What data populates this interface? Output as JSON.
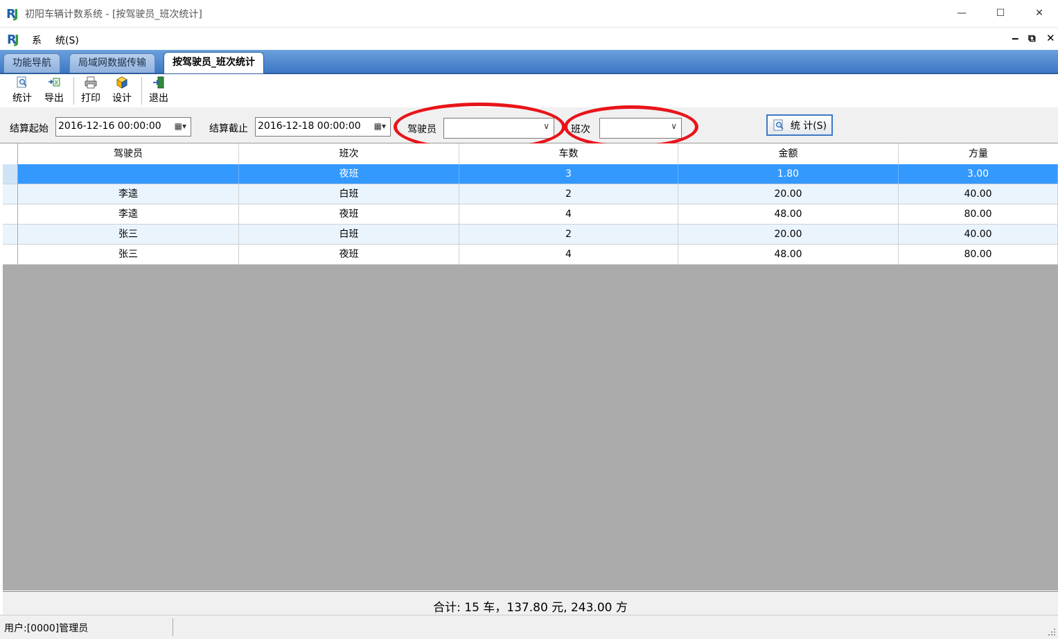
{
  "window": {
    "title": "初阳车辆计数系统 - [按驾驶员_班次统计]",
    "minimize": "—",
    "maximize": "☐",
    "close": "✕"
  },
  "menu": {
    "items": [
      "系",
      "统(S)"
    ],
    "mdi_min": "‒",
    "mdi_restore": "⧉",
    "mdi_close": "✕"
  },
  "tabs": [
    {
      "label": "功能导航",
      "active": false
    },
    {
      "label": "局域网数据传输",
      "active": false
    },
    {
      "label": "按驾驶员_班次统计",
      "active": true
    }
  ],
  "toolbar": {
    "buttons": [
      {
        "label": "统计",
        "icon": "search-report-icon"
      },
      {
        "label": "导出",
        "icon": "excel-export-icon"
      },
      {
        "label": "打印",
        "icon": "printer-icon"
      },
      {
        "label": "设计",
        "icon": "design-cube-icon"
      },
      {
        "label": "退出",
        "icon": "exit-door-icon"
      }
    ]
  },
  "filters": {
    "start_label": "结算起始",
    "start_value": "2016-12-16 00:00:00",
    "end_label": "结算截止",
    "end_value": "2016-12-18 00:00:00",
    "driver_label": "驾驶员",
    "driver_value": "",
    "shift_label": "班次",
    "shift_value": "",
    "stat_button": "统 计(S)"
  },
  "table": {
    "columns": [
      "驾驶员",
      "班次",
      "车数",
      "金额",
      "方量"
    ],
    "rows": [
      [
        "",
        "夜班",
        "3",
        "1.80",
        "3.00"
      ],
      [
        "李逵",
        "白班",
        "2",
        "20.00",
        "40.00"
      ],
      [
        "李逵",
        "夜班",
        "4",
        "48.00",
        "80.00"
      ],
      [
        "张三",
        "白班",
        "2",
        "20.00",
        "40.00"
      ],
      [
        "张三",
        "夜班",
        "4",
        "48.00",
        "80.00"
      ]
    ],
    "selected_row": 0
  },
  "summary": "合计: 15 车，137.80 元, 243.00 方",
  "status": {
    "user": "用户:[0000]管理员"
  },
  "colors": {
    "selection": "#3399ff",
    "tab_strip": "#3d78c4",
    "annotation_ring": "#e8141a"
  }
}
